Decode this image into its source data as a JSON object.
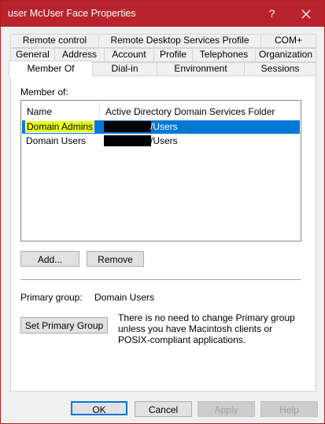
{
  "window": {
    "title": "user McUser Face Properties",
    "help_glyph": "?",
    "accent_color": "#b8232f"
  },
  "tabs": {
    "row1": [
      "Remote control",
      "Remote Desktop Services Profile",
      "COM+"
    ],
    "row2": [
      "General",
      "Address",
      "Account",
      "Profile",
      "Telephones",
      "Organization"
    ],
    "row3": [
      "Member Of",
      "Dial-in",
      "Environment",
      "Sessions"
    ],
    "active": "Member Of"
  },
  "member_of": {
    "label": "Member of:",
    "columns": [
      "Name",
      "Active Directory Domain Services Folder"
    ],
    "rows": [
      {
        "name": "Domain Admins",
        "folder": "/Users",
        "selected": true
      },
      {
        "name": "Domain Users",
        "folder": "/Users",
        "selected": false
      }
    ]
  },
  "buttons": {
    "add": "Add...",
    "remove": "Remove",
    "set_primary": "Set Primary Group",
    "ok": "OK",
    "cancel": "Cancel",
    "apply": "Apply",
    "help": "Help"
  },
  "primary_group": {
    "label": "Primary group:",
    "value": "Domain Users",
    "note": "There is no need to change Primary group unless you have Macintosh clients or POSIX-compliant applications."
  },
  "icons": {
    "close": "close-icon"
  }
}
